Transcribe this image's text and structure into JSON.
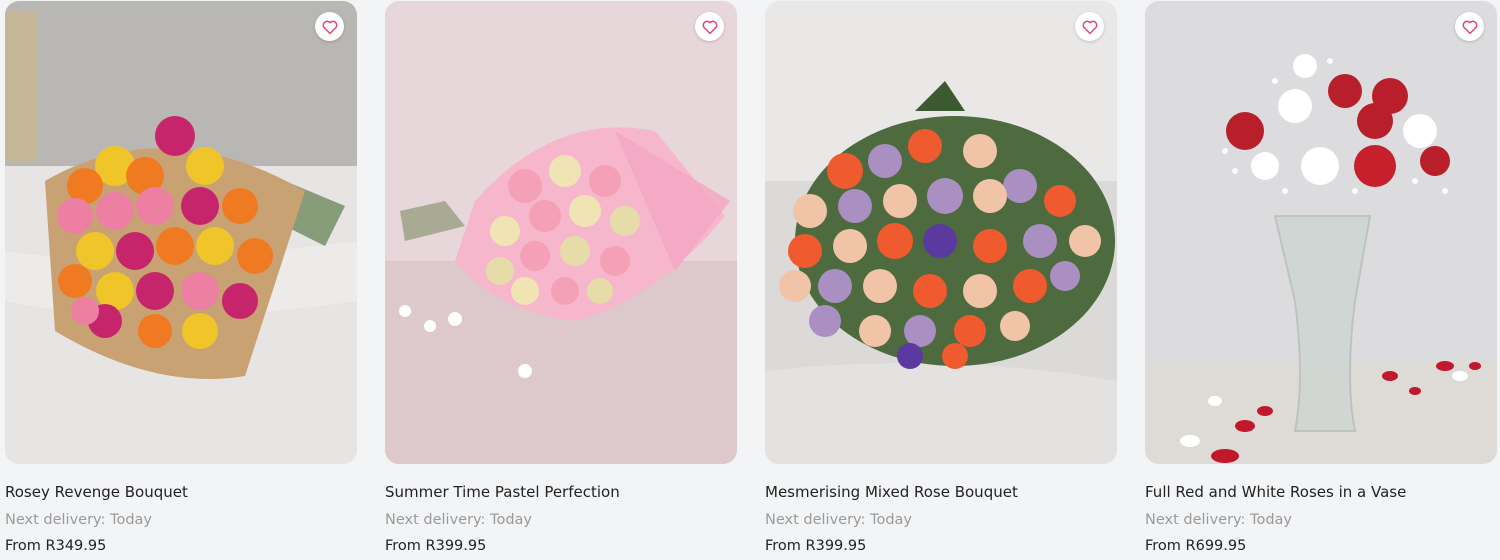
{
  "colors": {
    "heart": "#e0447a",
    "background": "#f3f4f6"
  },
  "wishlist_icon": "heart-outline-icon",
  "products": [
    {
      "name": "Rosey Revenge Bouquet",
      "delivery": "Next delivery: Today",
      "price": "From R349.95",
      "image": "mixed-bright-roses-kraft-wrap"
    },
    {
      "name": "Summer Time Pastel Perfection",
      "delivery": "Next delivery: Today",
      "price": "From R399.95",
      "image": "pastel-roses-pink-wrap"
    },
    {
      "name": "Mesmerising Mixed Rose Bouquet",
      "delivery": "Next delivery: Today",
      "price": "From R399.95",
      "image": "mixed-purple-orange-rose-bouquet"
    },
    {
      "name": "Full Red and White Roses in a Vase",
      "delivery": "Next delivery: Today",
      "price": "From R699.95",
      "image": "red-white-roses-glass-vase"
    }
  ]
}
